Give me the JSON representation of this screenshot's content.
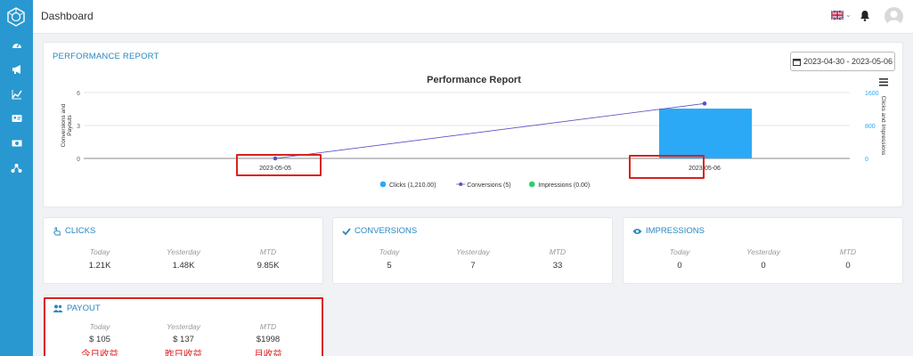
{
  "header": {
    "title": "Dashboard"
  },
  "performance": {
    "heading": "PERFORMANCE REPORT",
    "date_range": "2023-04-30 - 2023-05-06"
  },
  "chart_data": {
    "type": "bar",
    "title": "Performance Report",
    "categories": [
      "2023-05-05",
      "2023-05-06"
    ],
    "ylabel_left": "Conversions and Payouts",
    "ylabel_right": "Clicks and Impressions",
    "left_ticks": [
      "6",
      "3",
      "0"
    ],
    "right_ticks": [
      "1600",
      "800",
      "0"
    ],
    "ylim_left": [
      0,
      6
    ],
    "ylim_right": [
      0,
      1600
    ],
    "series": [
      {
        "name": "Clicks (1,210.00)",
        "kind": "bar",
        "axis": "right",
        "values": [
          0,
          1210
        ],
        "color": "#2ca9f6"
      },
      {
        "name": "Conversions (5)",
        "kind": "line",
        "axis": "left",
        "values": [
          0,
          5
        ],
        "color": "#5b4fc4"
      },
      {
        "name": "Impressions (0.00)",
        "kind": "line",
        "axis": "right",
        "values": [
          0,
          0
        ],
        "color": "#2ecc71"
      }
    ],
    "legend_position": "bottom-center"
  },
  "stats": {
    "column_labels": [
      "Today",
      "Yesterday",
      "MTD"
    ],
    "clicks": {
      "title": "CLICKS",
      "values": [
        "1.21K",
        "1.48K",
        "9.85K"
      ]
    },
    "conversions": {
      "title": "CONVERSIONS",
      "values": [
        "5",
        "7",
        "33"
      ]
    },
    "impressions": {
      "title": "IMPRESSIONS",
      "values": [
        "0",
        "0",
        "0"
      ]
    },
    "payout": {
      "title": "PAYOUT",
      "values": [
        "$ 105",
        "$ 137",
        "$1998"
      ],
      "annotations": [
        "今日收益",
        "昨日收益",
        "月收益"
      ]
    }
  },
  "colors": {
    "sidebar": "#2a98d0",
    "accent": "#2a88c0",
    "highlight": "#d9211e"
  }
}
